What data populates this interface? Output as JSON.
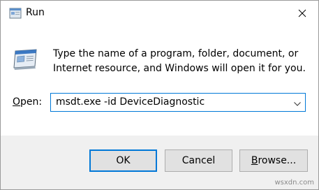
{
  "window": {
    "title": "Run",
    "close_glyph": "✕",
    "icons": {
      "app": "run-icon",
      "close": "close-icon",
      "dropdown": "chevron-down-icon"
    }
  },
  "content": {
    "description": "Type the name of a program, folder, document, or Internet resource, and Windows will open it for you.",
    "open_label_prefix": "O",
    "open_label_rest": "pen:",
    "open_value": "msdt.exe -id DeviceDiagnostic"
  },
  "buttons": {
    "ok": "OK",
    "cancel": "Cancel",
    "browse_prefix": "B",
    "browse_rest": "rowse..."
  },
  "watermark": "wsxdn.com",
  "colors": {
    "accent": "#0078d7",
    "footer_bg": "#f0f0f0",
    "button_bg": "#e1e1e1"
  }
}
